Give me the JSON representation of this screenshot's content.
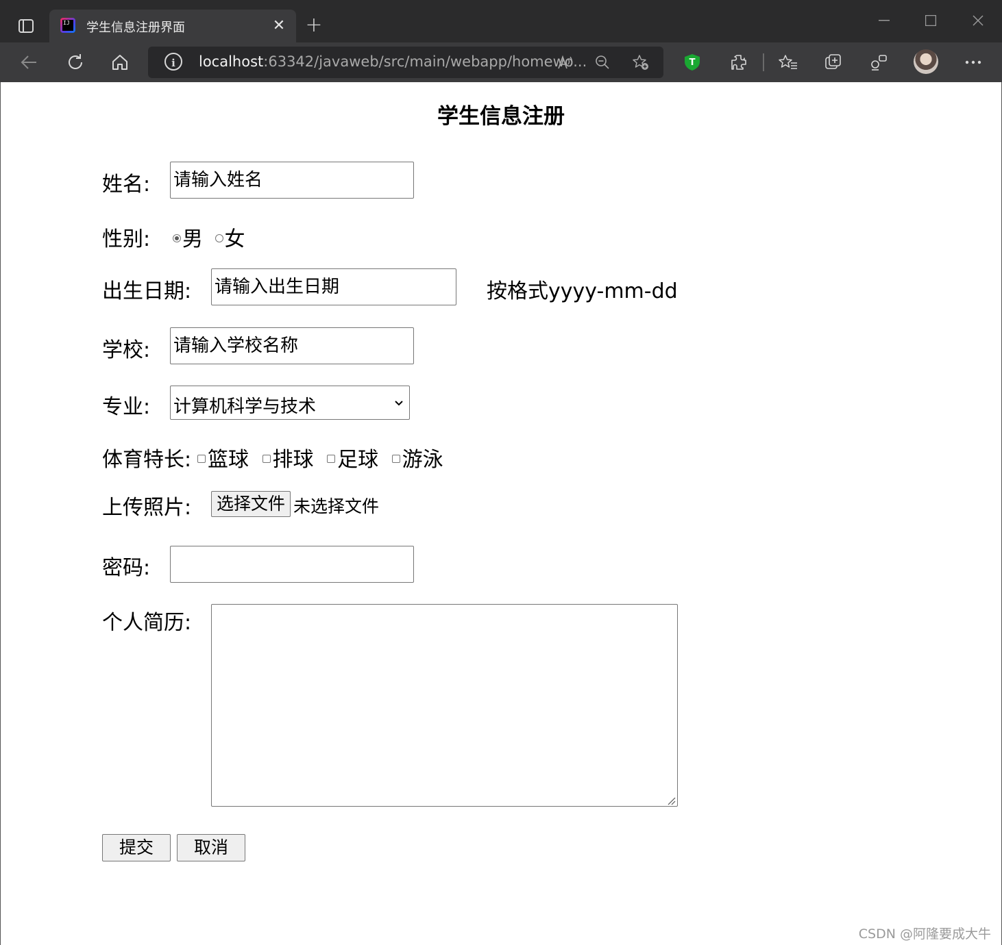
{
  "browser": {
    "tab_title": "学生信息注册界面",
    "new_tab": "+",
    "url_host": "localhost",
    "url_rest": ":63342/javaweb/src/main/webapp/homewo..."
  },
  "form": {
    "title": "学生信息注册",
    "name_label": "姓名:",
    "name_placeholder": "请输入姓名",
    "gender_label": "性别:",
    "gender_options": [
      "男",
      "女"
    ],
    "gender_selected": "男",
    "birth_label": "出生日期:",
    "birth_placeholder": "请输入出生日期",
    "birth_hint": "按格式yyyy-mm-dd",
    "school_label": "学校:",
    "school_placeholder": "请输入学校名称",
    "major_label": "专业:",
    "major_selected": "计算机科学与技术",
    "sports_label": "体育特长:",
    "sports_options": [
      "篮球",
      "排球",
      "足球",
      "游泳"
    ],
    "photo_label": "上传照片:",
    "photo_button": "选择文件",
    "photo_status": "未选择文件",
    "password_label": "密码:",
    "resume_label": "个人简历:",
    "submit_label": "提交",
    "cancel_label": "取消"
  },
  "watermark": "CSDN @阿隆要成大牛"
}
